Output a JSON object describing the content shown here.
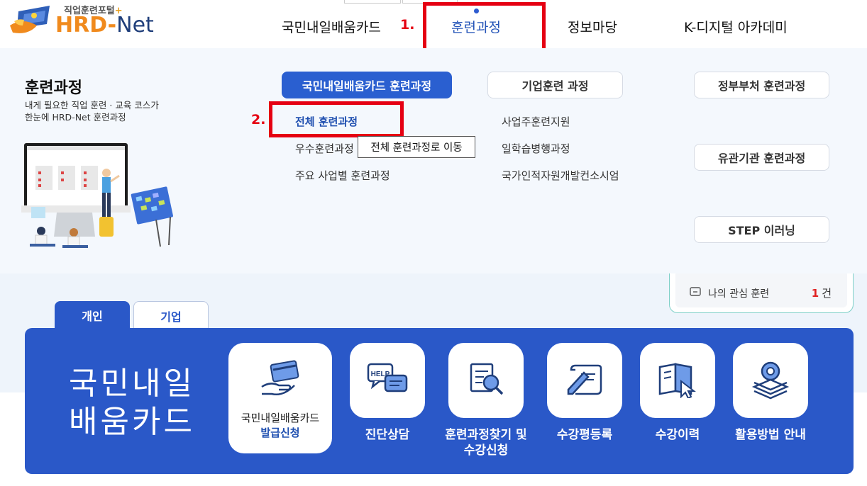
{
  "logo": {
    "subtitle": "직업훈련포털",
    "plus": "+",
    "hrd": "HRD",
    "dash": "-",
    "net": "Net"
  },
  "gnb": [
    {
      "label": "국민내일배움카드"
    },
    {
      "label": "훈련과정"
    },
    {
      "label": "정보마당"
    },
    {
      "label": "K-디지털 아카데미"
    }
  ],
  "annotations": {
    "step1": "1.",
    "step2": "2."
  },
  "mega_menu": {
    "title": "훈련과정",
    "desc_line1": "내게 필요한 직업 훈련 · 교육 코스가",
    "desc_line2": "한눈에 HRD-Net 훈련과정",
    "col1": {
      "header": "국민내일배움카드 훈련과정",
      "links": [
        "전체 훈련과정",
        "우수훈련과정",
        "주요 사업별 훈련과정"
      ]
    },
    "col2": {
      "header": "기업훈련 과정",
      "links": [
        "사업주훈련지원",
        "일학습병행과정",
        "국가인적자원개발컨소시엄"
      ]
    },
    "col3": {
      "buttons": [
        "정부부처 훈련과정",
        "유관기관 훈련과정",
        "STEP 이러닝"
      ]
    },
    "tooltip": "전체 훈련과정로 이동"
  },
  "favorites": {
    "label": "나의 관심 훈련",
    "count": "1",
    "unit": "건"
  },
  "tabs": [
    {
      "label": "개인"
    },
    {
      "label": "기업"
    }
  ],
  "panel": {
    "title_line1": "국민내일",
    "title_line2": "배움카드",
    "tiles": [
      {
        "icon": "card-in-hand-icon",
        "line1": "국민내일배움카드",
        "line2": "발급신청"
      },
      {
        "icon": "help-chat-icon",
        "line1": "진단상담",
        "line2": ""
      },
      {
        "icon": "document-search-icon",
        "line1": "훈련과정찾기 및",
        "line2": "수강신청"
      },
      {
        "icon": "pen-paper-icon",
        "line1": "수강평등록",
        "line2": ""
      },
      {
        "icon": "book-cursor-icon",
        "line1": "수강이력",
        "line2": ""
      },
      {
        "icon": "gear-stack-icon",
        "line1": "활용방법 안내",
        "line2": ""
      }
    ]
  },
  "colors": {
    "primary_blue": "#2a58c8",
    "annotation_red": "#e50012",
    "brand_orange": "#f08a1d",
    "brand_navy": "#1f3e7a"
  }
}
